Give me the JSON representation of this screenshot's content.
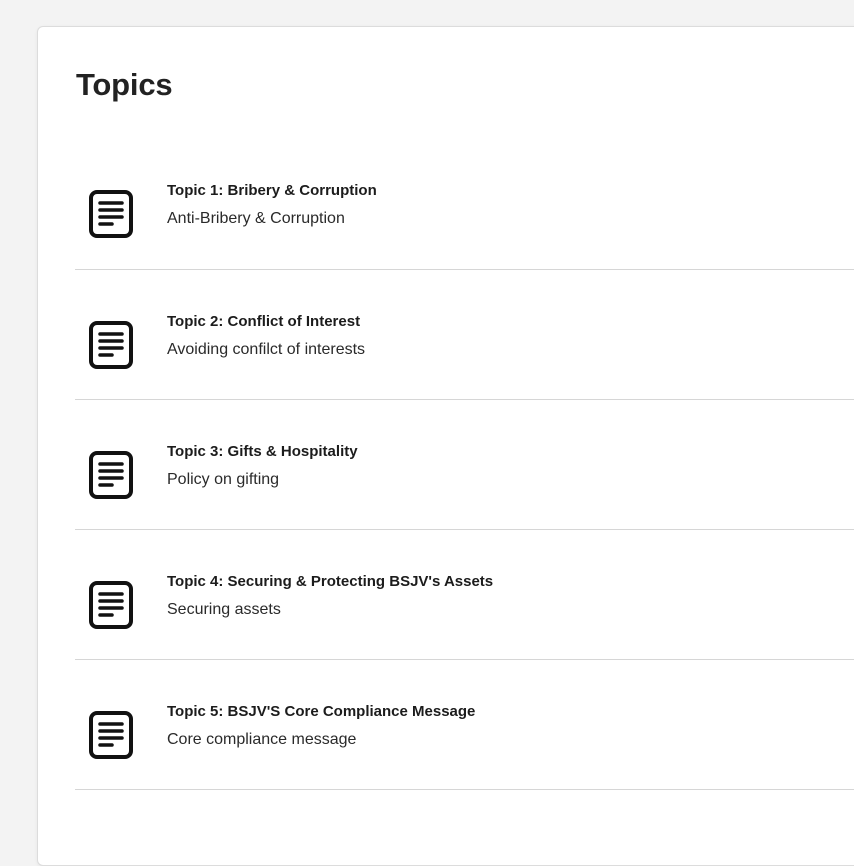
{
  "panel": {
    "title": "Topics"
  },
  "topics": [
    {
      "title": "Topic 1: Bribery & Corruption",
      "subtitle": "Anti-Bribery & Corruption",
      "icon": "document-icon"
    },
    {
      "title": "Topic 2: Conflict of Interest",
      "subtitle": "Avoiding confilct of interests",
      "icon": "document-icon"
    },
    {
      "title": "Topic 3: Gifts & Hospitality",
      "subtitle": "Policy on gifting",
      "icon": "document-icon"
    },
    {
      "title": "Topic 4: Securing & Protecting BSJV's Assets",
      "subtitle": "Securing assets",
      "icon": "document-icon"
    },
    {
      "title": "Topic 5: BSJV'S Core Compliance Message",
      "subtitle": "Core compliance message",
      "icon": "document-icon"
    }
  ]
}
